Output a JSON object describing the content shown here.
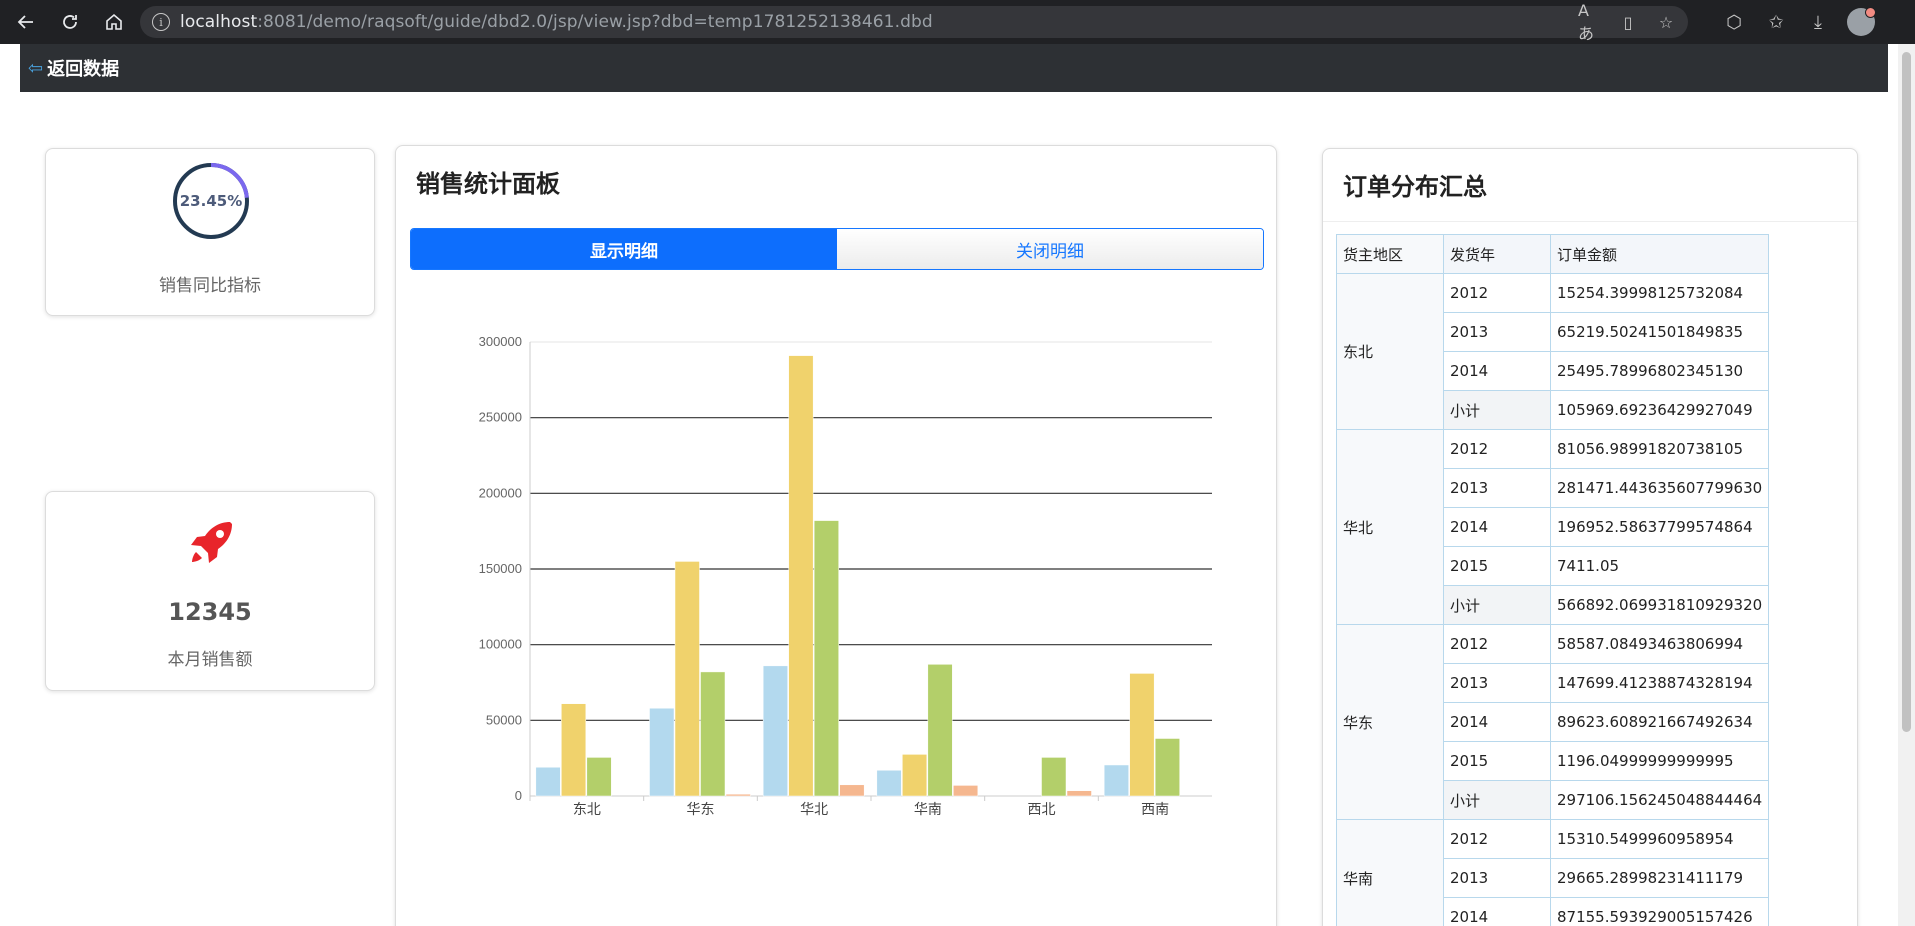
{
  "browser": {
    "url_host": "localhost",
    "url_rest": ":8081/demo/raqsoft/guide/dbd2.0/jsp/view.jsp?dbd=temp1781252138461.dbd"
  },
  "topbar": {
    "back_label": "返回数据"
  },
  "kpi_ratio": {
    "percent_text": "23.45%",
    "percent": 23.45,
    "label": "销售同比指标",
    "ring_color": "#7b68ee"
  },
  "kpi_sales": {
    "value": "12345",
    "label": "本月销售额",
    "icon_color": "#e8252b"
  },
  "panel": {
    "title": "销售统计面板",
    "show_detail": "显示明细",
    "close_detail": "关闭明细"
  },
  "chart_data": {
    "type": "bar",
    "categories": [
      "东北",
      "华东",
      "华北",
      "华南",
      "西北",
      "西南"
    ],
    "ylim": [
      0,
      300000
    ],
    "yticks": [
      0,
      50000,
      100000,
      150000,
      200000,
      250000,
      300000
    ],
    "grid": true,
    "series": [
      {
        "values": [
          19000,
          58000,
          86000,
          17000,
          0,
          20500
        ],
        "color": "#b3d9ee"
      },
      {
        "values": [
          61000,
          155000,
          291000,
          27500,
          0,
          81000
        ],
        "color": "#f0d26c"
      },
      {
        "values": [
          25500,
          82000,
          182000,
          87000,
          25500,
          38000
        ],
        "color": "#b3cf6a"
      },
      {
        "values": [
          0,
          1200,
          7400,
          7000,
          3500,
          0
        ],
        "color": "#f5b78f"
      }
    ]
  },
  "orders": {
    "title": "订单分布汇总",
    "headers": [
      "货主地区",
      "发货年",
      "订单金额"
    ],
    "groups": [
      {
        "region": "东北",
        "rows": [
          {
            "year": "2012",
            "amount": "15254.39998125732084"
          },
          {
            "year": "2013",
            "amount": "65219.50241501849835"
          },
          {
            "year": "2014",
            "amount": "25495.78996802345130"
          },
          {
            "year": "小计",
            "amount": "105969.69236429927049"
          }
        ]
      },
      {
        "region": "华北",
        "rows": [
          {
            "year": "2012",
            "amount": "81056.98991820738105"
          },
          {
            "year": "2013",
            "amount": "281471.443635607799630"
          },
          {
            "year": "2014",
            "amount": "196952.58637799574864"
          },
          {
            "year": "2015",
            "amount": "7411.05"
          },
          {
            "year": "小计",
            "amount": "566892.069931810929320"
          }
        ]
      },
      {
        "region": "华东",
        "rows": [
          {
            "year": "2012",
            "amount": "58587.08493463806994"
          },
          {
            "year": "2013",
            "amount": "147699.41238874328194"
          },
          {
            "year": "2014",
            "amount": "89623.608921667492634"
          },
          {
            "year": "2015",
            "amount": "1196.04999999999995"
          },
          {
            "year": "小计",
            "amount": "297106.156245048844464"
          }
        ]
      },
      {
        "region": "华南",
        "rows": [
          {
            "year": "2012",
            "amount": "15310.5499960958954"
          },
          {
            "year": "2013",
            "amount": "29665.28998231411179"
          },
          {
            "year": "2014",
            "amount": "87155.593929005157426"
          }
        ]
      }
    ]
  }
}
